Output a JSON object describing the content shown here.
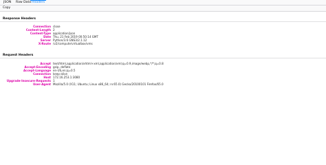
{
  "tabs": [
    {
      "label": "JSON",
      "selected": false
    },
    {
      "label": "Raw Data",
      "selected": false
    },
    {
      "label": "Headers",
      "selected": true
    }
  ],
  "toolbar": {
    "copy_label": "Copy"
  },
  "response_headers": {
    "title": "Response Headers",
    "rows": [
      {
        "name": "Connection",
        "value": "close"
      },
      {
        "name": "Content-Length",
        "value": "2"
      },
      {
        "name": "Content-Type",
        "value": "application/json"
      },
      {
        "name": "Date",
        "value": "Thu, 21 Feb 2019 00:50:14 GMT"
      },
      {
        "name": "Server",
        "value": "Python/3.6 GNS3/2.1.12"
      },
      {
        "name": "X-Route",
        "value": "/v2/compute/virtualbox/vms"
      }
    ]
  },
  "request_headers": {
    "title": "Request Headers",
    "rows": [
      {
        "name": "Accept",
        "value": "text/html,application/xhtml+xml,application/xml;q=0.9,image/webp,*/*;q=0.8"
      },
      {
        "name": "Accept-Encoding",
        "value": "gzip, deflate"
      },
      {
        "name": "Accept-Language",
        "value": "en-US,en;q=0.5"
      },
      {
        "name": "Connection",
        "value": "keep-alive"
      },
      {
        "name": "Host",
        "value": "172.16.253.1:3080"
      },
      {
        "name": "Upgrade-Insecure-Requests",
        "value": "1"
      },
      {
        "name": "User-Agent",
        "value": "Mozilla/5.0 (X11; Ubuntu; Linux x86_64; rv:65.0) Gecko/20100101 Firefox/65.0"
      }
    ]
  },
  "colors": {
    "accent": "#0a84ff",
    "header_name": "#dd00a9"
  }
}
